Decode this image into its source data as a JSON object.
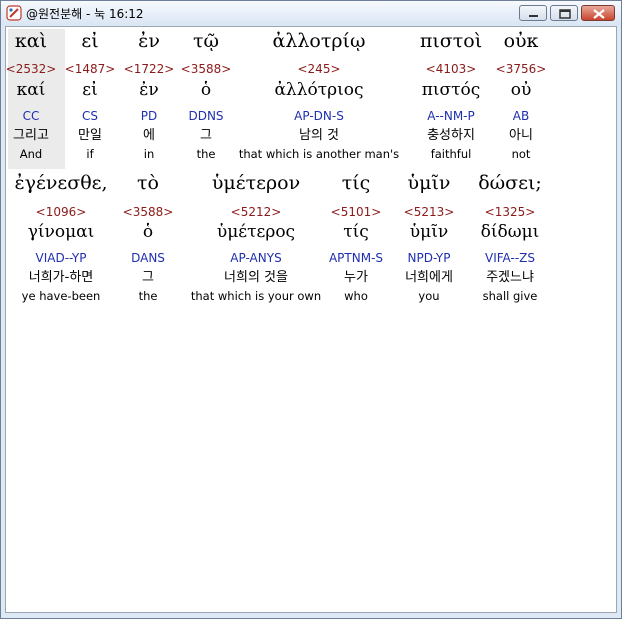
{
  "window": {
    "title": "@원전분해 - 눅 16:12",
    "buttons": [
      "minimize",
      "maximize",
      "close"
    ]
  },
  "lines": [
    {
      "words": [
        {
          "greek": "καὶ",
          "strong": "<2532>",
          "lemma": "καί",
          "parse": "CC",
          "korean": "그리고",
          "english": "And"
        },
        {
          "greek": "εἰ",
          "strong": "<1487>",
          "lemma": "εἰ",
          "parse": "CS",
          "korean": "만일",
          "english": "if"
        },
        {
          "greek": "ἐν",
          "strong": "<1722>",
          "lemma": "ἐν",
          "parse": "PD",
          "korean": "에",
          "english": "in"
        },
        {
          "greek": "τῷ",
          "strong": "<3588>",
          "lemma": "ὁ",
          "parse": "DDNS",
          "korean": "그",
          "english": "the"
        },
        {
          "greek": "ἀλλοτρίῳ",
          "strong": "<245>",
          "lemma": "ἀλλότριος",
          "parse": "AP-DN-S",
          "korean": "남의 것",
          "english": "that which is another man's"
        },
        {
          "greek": "πιστοὶ",
          "strong": "<4103>",
          "lemma": "πιστός",
          "parse": "A--NM-P",
          "korean": "충성하지",
          "english": "faithful"
        },
        {
          "greek": "οὐκ",
          "strong": "<3756>",
          "lemma": "οὐ",
          "parse": "AB",
          "korean": "아니",
          "english": "not"
        }
      ]
    },
    {
      "words": [
        {
          "greek": "ἐγένεσθε,",
          "strong": "<1096>",
          "lemma": "γίνομαι",
          "parse": "VIAD--YP",
          "korean": "너희가-하면",
          "english": "ye have-been"
        },
        {
          "greek": "τὸ",
          "strong": "<3588>",
          "lemma": "ὁ",
          "parse": "DANS",
          "korean": "그",
          "english": "the"
        },
        {
          "greek": "ὑμέτερον",
          "strong": "<5212>",
          "lemma": "ὑμέτερος",
          "parse": "AP-ANYS",
          "korean": "너희의 것을",
          "english": "that which is your own"
        },
        {
          "greek": "τίς",
          "strong": "<5101>",
          "lemma": "τίς",
          "parse": "APTNM-S",
          "korean": "누가",
          "english": "who"
        },
        {
          "greek": "ὑμῖν",
          "strong": "<5213>",
          "lemma": "ὑμῖν",
          "parse": "NPD-YP",
          "korean": "너희에게",
          "english": "you"
        },
        {
          "greek": "δώσει;",
          "strong": "<1325>",
          "lemma": "δίδωμι",
          "parse": "VIFA--ZS",
          "korean": "주겠느냐",
          "english": "shall give"
        }
      ]
    }
  ],
  "colors": {
    "strong": "#8b1a1a",
    "parse": "#1f2fb0",
    "highlight": "#ebebeb"
  }
}
